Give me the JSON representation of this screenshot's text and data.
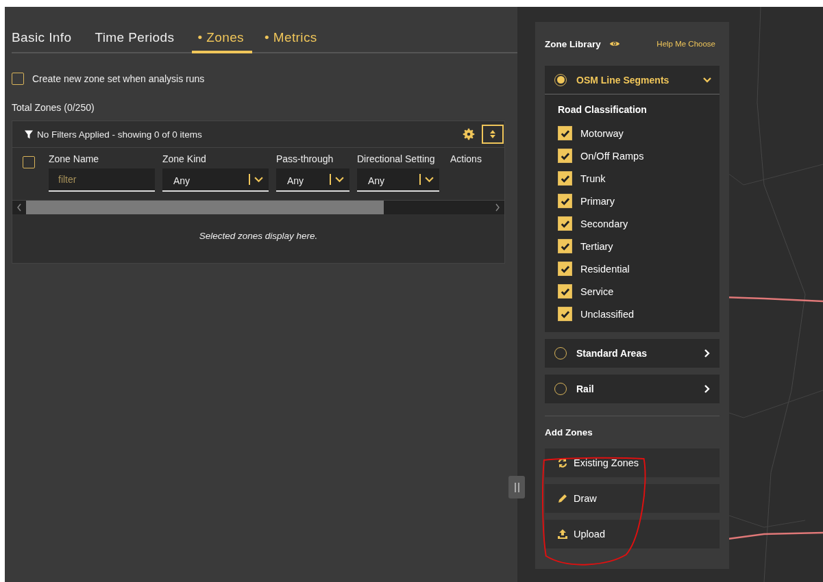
{
  "tabs": [
    {
      "label": "Basic Info",
      "flagged": false,
      "selected": false
    },
    {
      "label": "Time Periods",
      "flagged": false,
      "selected": false
    },
    {
      "label": "• Zones",
      "flagged": true,
      "selected": true
    },
    {
      "label": "• Metrics",
      "flagged": true,
      "selected": false
    }
  ],
  "new_zone_set": {
    "label": "Create new zone set when analysis runs",
    "checked": false
  },
  "total_zones": "Total Zones (0/250)",
  "table": {
    "filter_status": "No Filters Applied - showing 0 of 0 items",
    "select_all": {
      "checked": false
    },
    "columns": [
      {
        "label": "Zone Name",
        "kind": "text",
        "placeholder": "filter"
      },
      {
        "label": "Zone Kind",
        "kind": "select",
        "value": "Any"
      },
      {
        "label": "Pass-through",
        "kind": "select",
        "value": "Any"
      },
      {
        "label": "Directional Setting",
        "kind": "select",
        "value": "Any"
      },
      {
        "label": "Actions",
        "kind": "none"
      }
    ],
    "empty_message": "Selected zones display here."
  },
  "zone_library": {
    "title": "Zone Library",
    "help_link": "Help Me Choose",
    "sections": [
      {
        "label": "OSM Line Segments",
        "selected": true,
        "expanded": true,
        "group_title": "Road Classification",
        "options": [
          {
            "label": "Motorway",
            "checked": true
          },
          {
            "label": "On/Off Ramps",
            "checked": true
          },
          {
            "label": "Trunk",
            "checked": true
          },
          {
            "label": "Primary",
            "checked": true
          },
          {
            "label": "Secondary",
            "checked": true
          },
          {
            "label": "Tertiary",
            "checked": true
          },
          {
            "label": "Residential",
            "checked": true
          },
          {
            "label": "Service",
            "checked": true
          },
          {
            "label": "Unclassified",
            "checked": true
          }
        ]
      },
      {
        "label": "Standard Areas",
        "selected": false,
        "expanded": false
      },
      {
        "label": "Rail",
        "selected": false,
        "expanded": false
      }
    ],
    "add_zones": {
      "title": "Add Zones",
      "actions": [
        {
          "label": "Existing Zones",
          "kind": "sync"
        },
        {
          "label": "Draw",
          "kind": "pencil"
        },
        {
          "label": "Upload",
          "kind": "upload"
        }
      ]
    }
  }
}
